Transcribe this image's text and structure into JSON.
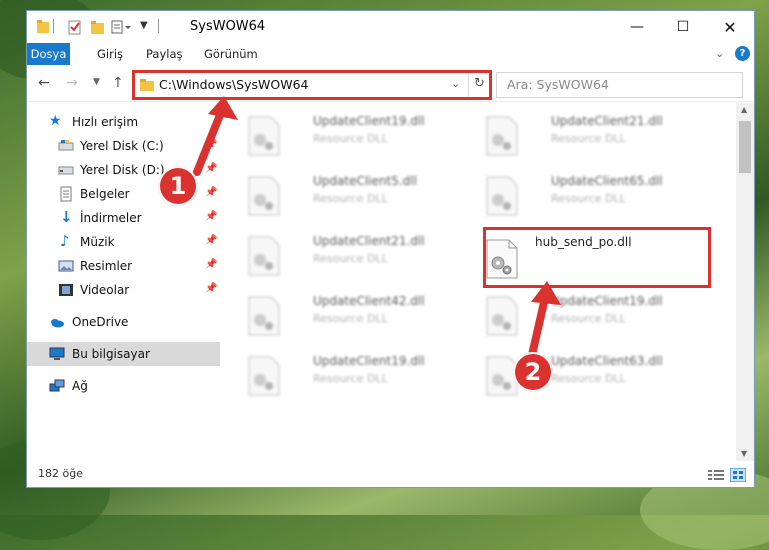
{
  "window": {
    "title": "SysWOW64",
    "controls": [
      "minimize",
      "maximize",
      "close"
    ]
  },
  "ribbon": {
    "tabs": [
      {
        "label": "Dosya",
        "active": true
      },
      {
        "label": "Giriş",
        "active": false
      },
      {
        "label": "Paylaş",
        "active": false
      },
      {
        "label": "Görünüm",
        "active": false
      }
    ]
  },
  "address": {
    "path": "C:\\Windows\\SysWOW64",
    "search_placeholder": "Ara: SysWOW64"
  },
  "sidebar": {
    "items": [
      {
        "label": "Hızlı erişim",
        "icon": "star-icon"
      },
      {
        "label": "Yerel Disk (C:)",
        "icon": "drive-icon",
        "pinned": true
      },
      {
        "label": "Yerel Disk (D:)",
        "icon": "drive-icon",
        "pinned": true
      },
      {
        "label": "Belgeler",
        "icon": "documents-icon",
        "pinned": true
      },
      {
        "label": "İndirmeler",
        "icon": "download-icon",
        "pinned": true
      },
      {
        "label": "Müzik",
        "icon": "music-icon",
        "pinned": true
      },
      {
        "label": "Resimler",
        "icon": "pictures-icon",
        "pinned": true
      },
      {
        "label": "Videolar",
        "icon": "videos-icon",
        "pinned": true
      },
      {
        "label": "OneDrive",
        "icon": "cloud-icon"
      },
      {
        "label": "Bu bilgisayar",
        "icon": "computer-icon",
        "selected": true
      },
      {
        "label": "Ağ",
        "icon": "network-icon"
      }
    ]
  },
  "files": {
    "left": [
      {
        "name": "UpdateClient19.dll",
        "type": "Resource DLL"
      },
      {
        "name": "UpdateClient5.dll",
        "type": "Resource DLL"
      },
      {
        "name": "UpdateClient21.dll",
        "type": "Resource DLL"
      },
      {
        "name": "UpdateClient42.dll",
        "type": "Resource DLL"
      },
      {
        "name": "UpdateClient19.dll",
        "type": "Resource DLL"
      }
    ],
    "right": [
      {
        "name": "UpdateClient21.dll",
        "type": "Resource DLL"
      },
      {
        "name": "UpdateClient65.dll",
        "type": "Resource DLL"
      },
      {
        "name": "hub_send_po.dll",
        "type": ""
      },
      {
        "name": "UpdateClient19.dll",
        "type": "Resource DLL"
      },
      {
        "name": "UpdateClient63.dll",
        "type": "Resource DLL"
      }
    ]
  },
  "status": {
    "item_count": "182 öğe"
  },
  "callouts": {
    "step1": "1",
    "step2": "2"
  },
  "colors": {
    "accent": "#1979ca",
    "highlight_red": "#d9322f"
  }
}
